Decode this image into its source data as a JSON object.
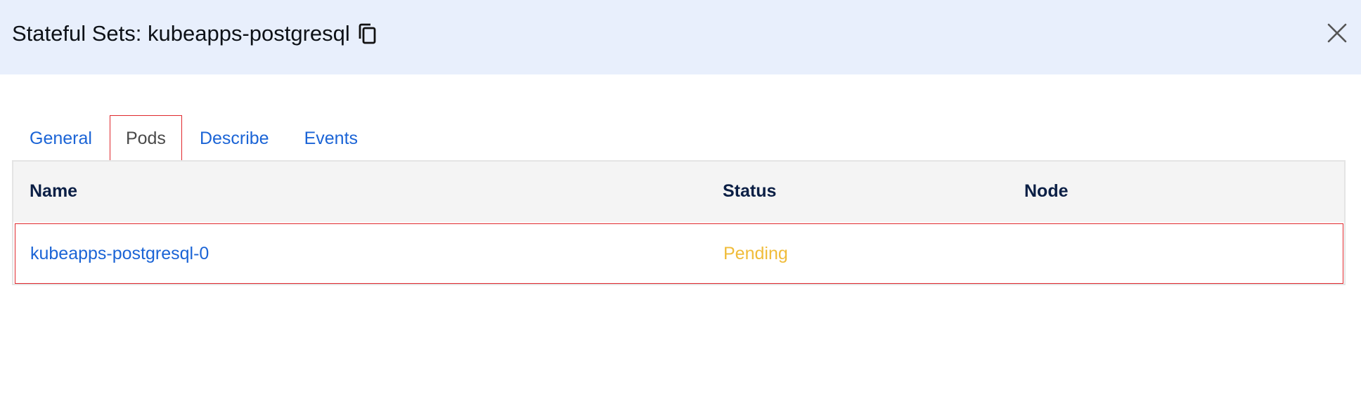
{
  "header": {
    "title": "Stateful Sets: kubeapps-postgresql",
    "copy_icon": "copy-icon",
    "close_icon": "close-icon"
  },
  "tabs": [
    {
      "label": "General",
      "active": false
    },
    {
      "label": "Pods",
      "active": true
    },
    {
      "label": "Describe",
      "active": false
    },
    {
      "label": "Events",
      "active": false
    }
  ],
  "table": {
    "columns": [
      "Name",
      "Status",
      "Node"
    ],
    "rows": [
      {
        "name": "kubeapps-postgresql-0",
        "status": "Pending",
        "node": ""
      }
    ]
  },
  "colors": {
    "header_bg": "#e8effc",
    "link": "#1b64d6",
    "pending": "#f0bc3a",
    "highlight": "#e0282d"
  }
}
